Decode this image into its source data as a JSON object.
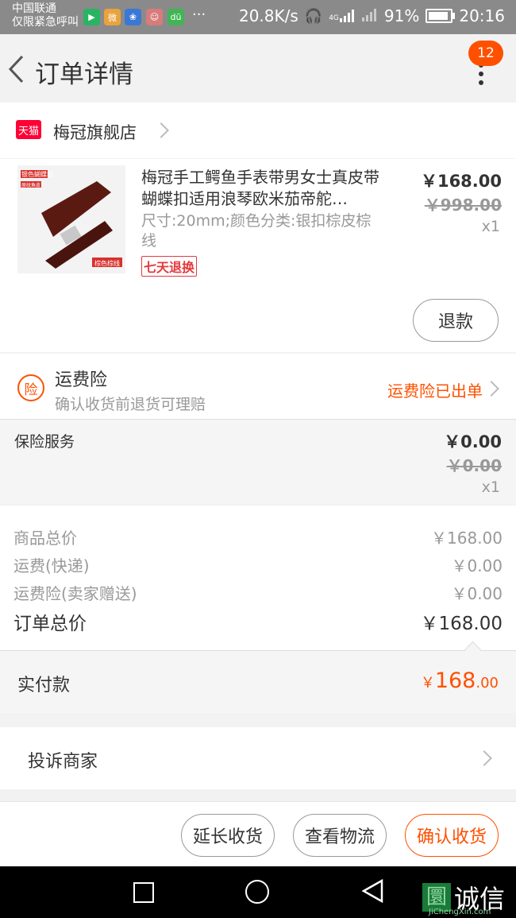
{
  "status_bar": {
    "carrier_line1": "中国联通",
    "carrier_line2": "仅限紧急呼叫",
    "more": "···",
    "net_speed": "20.8K/s",
    "net_type": "4G",
    "battery": "91%",
    "battery_level": 0.91,
    "time": "20:16"
  },
  "header": {
    "title": "订单详情",
    "badge_count": "12"
  },
  "shop": {
    "logo_text": "天猫",
    "name": "梅冠旗舰店"
  },
  "product": {
    "title": "梅冠手工鳄鱼手表带男女士真皮带蝴蝶扣适用浪琴欧米茄帝舵…",
    "sku": "尺寸:20mm;颜色分类:银扣棕皮棕线",
    "tag": "七天退换",
    "price": "￥168.00",
    "original_price": "￥998.00",
    "quantity": "x1",
    "img_label_1": "银色蝴蝶扣",
    "img_label_2": "原纹鱼皮",
    "img_label_3": "棕色棕线",
    "refund_button": "退款"
  },
  "insurance": {
    "icon_text": "险",
    "title": "运费险",
    "subtitle": "确认收货前退货可理赔",
    "status": "运费险已出单"
  },
  "service": {
    "name": "保险服务",
    "price": "￥0.00",
    "original_price": "￥0.00",
    "quantity": "x1"
  },
  "summary": {
    "rows": [
      {
        "label": "商品总价",
        "value": "￥168.00"
      },
      {
        "label": "运费(快递)",
        "value": "￥0.00"
      },
      {
        "label": "运费险(卖家赠送)",
        "value": "￥0.00"
      }
    ],
    "total_label": "订单总价",
    "total_value": "￥168.00",
    "paid_label": "实付款",
    "paid_currency": "￥",
    "paid_int": "168",
    "paid_dec": ".00"
  },
  "complaint": {
    "label": "投诉商家"
  },
  "actions": {
    "extend": "延长收货",
    "logistics": "查看物流",
    "confirm": "确认收货"
  },
  "watermark": {
    "text": "诚信",
    "sub": "JiChengXin.com"
  },
  "colors": {
    "accent": "#ff5000",
    "tmall_red": "#ff0036"
  }
}
